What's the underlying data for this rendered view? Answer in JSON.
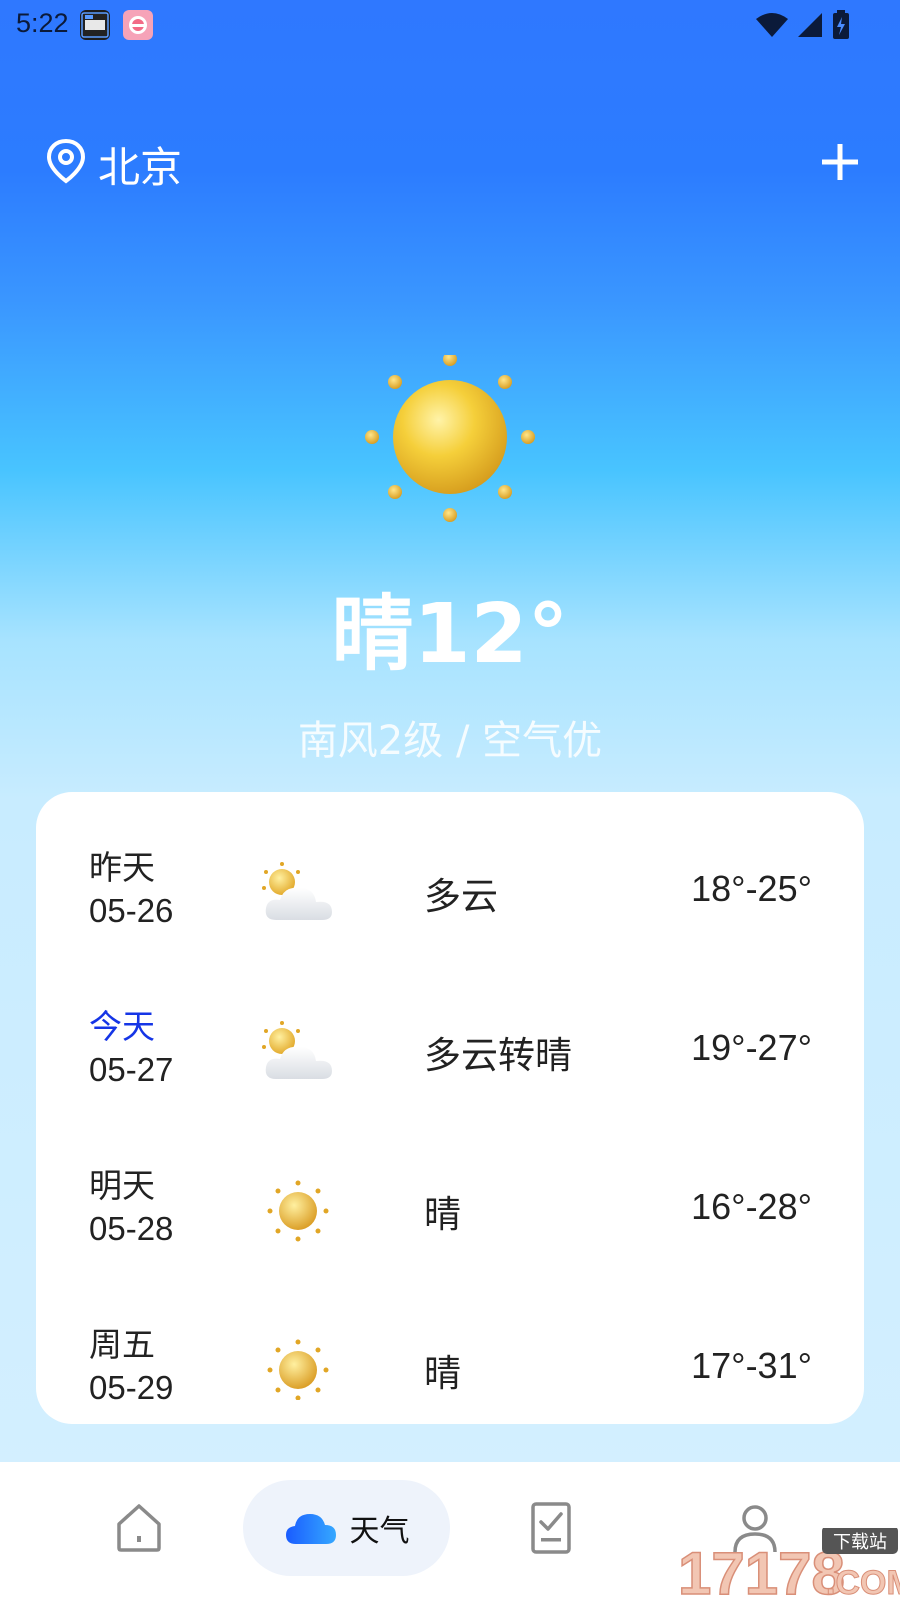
{
  "status_bar": {
    "time": "5:22",
    "icons": [
      "calendar-widget-icon",
      "pink-app-icon",
      "wifi-icon",
      "cell-signal-icon",
      "battery-charging-icon"
    ]
  },
  "header": {
    "city": "北京",
    "location_icon": "location-pin-icon",
    "add_icon": "plus-icon"
  },
  "current": {
    "condition_icon": "sun-icon",
    "condition_temp": "晴12°",
    "details": "南风2级 / 空气优"
  },
  "forecast": [
    {
      "day": "昨天",
      "date": "05-26",
      "icon": "partly-cloudy-icon",
      "condition": "多云",
      "range": "18°-25°",
      "highlight": false
    },
    {
      "day": "今天",
      "date": "05-27",
      "icon": "partly-cloudy-icon",
      "condition": "多云转晴",
      "range": "19°-27°",
      "highlight": true
    },
    {
      "day": "明天",
      "date": "05-28",
      "icon": "sun-icon",
      "condition": "晴",
      "range": "16°-28°",
      "highlight": false
    },
    {
      "day": "周五",
      "date": "05-29",
      "icon": "sun-icon",
      "condition": "晴",
      "range": "17°-31°",
      "highlight": false
    }
  ],
  "nav": {
    "items": [
      {
        "icon": "home-icon",
        "label": ""
      },
      {
        "icon": "cloud-icon",
        "label": "天气",
        "active": true
      },
      {
        "icon": "checklist-icon",
        "label": ""
      },
      {
        "icon": "profile-icon",
        "label": ""
      }
    ]
  },
  "watermark": {
    "brand": "17178",
    "suffix": ".COM",
    "tag": "下载站"
  },
  "colors": {
    "accent": "#1535e6",
    "sky_top": "#2f78ff",
    "sky_mid": "#48c4ff",
    "sun": "#f0c23a"
  }
}
